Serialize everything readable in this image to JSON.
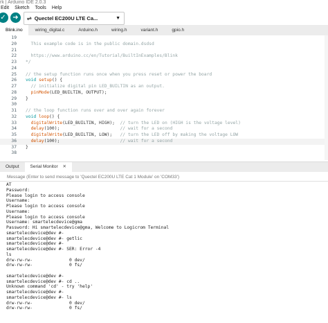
{
  "window": {
    "title": "rk | Arduino IDE 2.0.3"
  },
  "menu": [
    "Edit",
    "Sketch",
    "Tools",
    "Help"
  ],
  "toolbar": {
    "verify_icon": "check-icon",
    "upload_icon": "arrow-right-icon",
    "board": "Quectel EC200U LTE Ca...",
    "board_icon": "usb-icon",
    "accent": "#008184"
  },
  "tabs": [
    "Blink.ino",
    "wiring_digital.c",
    "Arduino.h",
    "wiring.h",
    "variant.h",
    "gpio.h"
  ],
  "editor": {
    "lines": [
      {
        "n": "19",
        "text": ""
      },
      {
        "n": "20",
        "text": "  This example code is in the public domain.dsdsd"
      },
      {
        "n": "21",
        "text": ""
      },
      {
        "n": "22",
        "text": "  https://www.arduino.cc/en/Tutorial/BuiltInExamples/Blink"
      },
      {
        "n": "23",
        "text": "*/"
      },
      {
        "n": "24",
        "text": ""
      },
      {
        "n": "25",
        "text": "// the setup function runs once when you press reset or power the board"
      },
      {
        "n": "26",
        "text": "void setup() {"
      },
      {
        "n": "27",
        "text": "  // initialize digital pin LED_BUILTIN as an output."
      },
      {
        "n": "28",
        "text": "  pinMode(LED_BUILTIN, OUTPUT);"
      },
      {
        "n": "29",
        "text": "}"
      },
      {
        "n": "30",
        "text": ""
      },
      {
        "n": "31",
        "text": "// the loop function runs over and over again forever"
      },
      {
        "n": "32",
        "text": "void loop() {"
      },
      {
        "n": "33",
        "text": "  digitalWrite(LED_BUILTIN, HIGH);  // turn the LED on (HIGH is the voltage level)"
      },
      {
        "n": "34",
        "text": "  delay(100);                       // wait for a second"
      },
      {
        "n": "35",
        "text": "  digitalWrite(LED_BUILTIN, LOW);   // turn the LED off by making the voltage LOW"
      },
      {
        "n": "36",
        "text": "  delay(100);                       // wait for a second"
      },
      {
        "n": "37",
        "text": "}"
      },
      {
        "n": "38",
        "text": ""
      }
    ]
  },
  "bottom_panel": {
    "tabs": [
      "Output",
      "Serial Monitor"
    ],
    "close_icon": "close-icon",
    "input_placeholder": "Message (Enter to send message to 'Quectel EC200U LTE Cat 1 Module' on 'COM33')",
    "output": [
      "AT",
      "Password:",
      "Please login to access console",
      "Username:",
      "Please login to access console",
      "Username:",
      "Please login to access console",
      "Username: smartelecdevice@gma",
      "Password: Hi smartelecdevice@gma, Welcome to Logicrom Terminal",
      "smartelecdevice@dev #-",
      "smartelecdevice@dev #- getlic",
      "smartelecdevice@dev #-",
      "smartelecdevice@dev #- SER: Error -4",
      "ls",
      "drw-rw-rw-              0 dev/",
      "drw-rw-rw-              0 fs/",
      "",
      "smartelecdevice@dev #-",
      "smartelecdevice@dev #- cd ..",
      "Unknown command 'cd' - try 'help'",
      "smartelecdevice@dev #-",
      "smartelecdevice@dev #- ls",
      "drw-rw-rw-              0 dev/",
      "drw-rw-rw-              0 fs/"
    ]
  }
}
